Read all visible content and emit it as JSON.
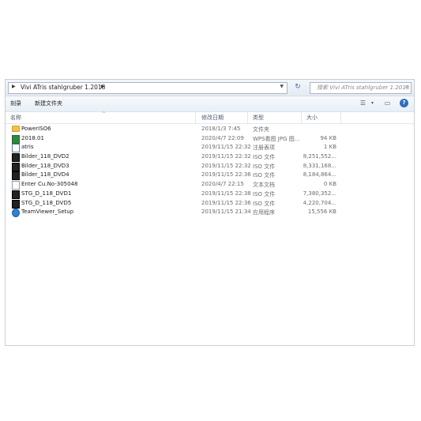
{
  "address_bar": {
    "breadcrumb": "Vivi ATris stahlgruber 1.2018",
    "arrow_icon": "chevron-right-icon",
    "refresh_icon": "refresh-icon"
  },
  "search": {
    "placeholder": "搜索 Vivi ATris stahlgruber 1.2018"
  },
  "toolbar": {
    "burn_label": "刻录",
    "new_folder_label": "新建文件夹"
  },
  "columns": {
    "name": "名称",
    "date": "修改日期",
    "type": "类型",
    "size": "大小"
  },
  "files": [
    {
      "name": "PowerISO6",
      "date": "2018/1/3 7:45",
      "type": "文件夹",
      "size": "",
      "icon": "folder-icon"
    },
    {
      "name": "2018.01",
      "date": "2020/4/7 22:09",
      "type": "WPS看图 JPG 图...",
      "size": "94 KB",
      "icon": "image-file-icon"
    },
    {
      "name": "atris",
      "date": "2019/11/15 22:32",
      "type": "注册表项",
      "size": "1 KB",
      "icon": "registry-file-icon"
    },
    {
      "name": "Bilder_118_DVD2",
      "date": "2019/11/15 22:32",
      "type": "ISO 文件",
      "size": "8,251,552...",
      "icon": "iso-file-icon"
    },
    {
      "name": "Bilder_118_DVD3",
      "date": "2019/11/15 22:32",
      "type": "ISO 文件",
      "size": "8,331,168...",
      "icon": "iso-file-icon"
    },
    {
      "name": "Bilder_118_DVD4",
      "date": "2019/11/15 22:36",
      "type": "ISO 文件",
      "size": "8,184,864...",
      "icon": "iso-file-icon"
    },
    {
      "name": "Enter Cu.No-305048",
      "date": "2020/4/7 22:15",
      "type": "文本文档",
      "size": "0 KB",
      "icon": "text-file-icon"
    },
    {
      "name": "STG_D_118_DVD1",
      "date": "2019/11/15 22:38",
      "type": "ISO 文件",
      "size": "7,380,352...",
      "icon": "iso-file-icon"
    },
    {
      "name": "STG_D_118_DVD5",
      "date": "2019/11/15 22:36",
      "type": "ISO 文件",
      "size": "4,220,704...",
      "icon": "iso-file-icon"
    },
    {
      "name": "TeamViewer_Setup",
      "date": "2019/11/15 21:34",
      "type": "应用程序",
      "size": "15,556 KB",
      "icon": "teamviewer-app-icon"
    }
  ]
}
